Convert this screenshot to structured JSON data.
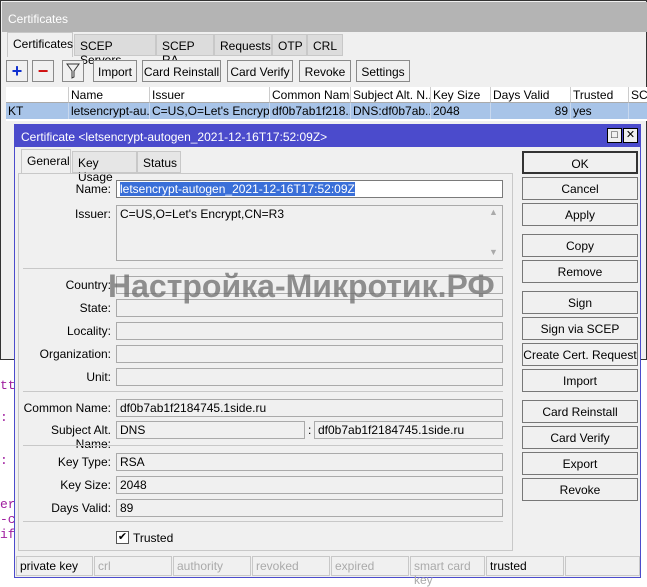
{
  "outer": {
    "title": "Certificates",
    "tabs": [
      "Certificates",
      "SCEP Servers",
      "SCEP RA",
      "Requests",
      "OTP",
      "CRL"
    ],
    "toolbar": {
      "add": "+",
      "remove": "−",
      "import": "Import",
      "card_reinstall": "Card Reinstall",
      "card_verify": "Card Verify",
      "revoke": "Revoke",
      "settings": "Settings"
    },
    "columns": [
      "",
      "Name",
      "Issuer",
      "Common Name",
      "Subject Alt. N...",
      "Key Size",
      "Days Valid",
      "Trusted",
      "SC"
    ],
    "row": [
      "KT",
      "letsencrypt-au...",
      "C=US,O=Let's Encrypt...",
      "df0b7ab1f218...",
      "DNS:df0b7ab...",
      "2048",
      "89",
      "yes",
      ""
    ]
  },
  "dialog": {
    "title": "Certificate <letsencrypt-autogen_2021-12-16T17:52:09Z>",
    "tabs": [
      "General",
      "Key Usage",
      "Status"
    ],
    "fields": {
      "name_label": "Name:",
      "name": "letsencrypt-autogen_2021-12-16T17:52:09Z",
      "issuer_label": "Issuer:",
      "issuer": "C=US,O=Let's Encrypt,CN=R3",
      "country_label": "Country:",
      "state_label": "State:",
      "locality_label": "Locality:",
      "organization_label": "Organization:",
      "unit_label": "Unit:",
      "common_name_label": "Common Name:",
      "common_name": "df0b7ab1f2184745.1side.ru",
      "san_label": "Subject Alt. Name:",
      "san_type": "DNS",
      "san_sep": ":",
      "san_value": "df0b7ab1f2184745.1side.ru",
      "key_type_label": "Key Type:",
      "key_type": "RSA",
      "key_size_label": "Key Size:",
      "key_size": "2048",
      "days_valid_label": "Days Valid:",
      "days_valid": "89",
      "trusted_label": "Trusted"
    },
    "trusted_checked": true,
    "buttons": [
      "OK",
      "Cancel",
      "Apply",
      "Copy",
      "Remove",
      "Sign",
      "Sign via SCEP",
      "Create Cert. Request",
      "Import",
      "Card Reinstall",
      "Card Verify",
      "Export",
      "Revoke"
    ],
    "status": [
      "private key",
      "crl",
      "authority",
      "revoked",
      "expired",
      "smart card key",
      "trusted",
      ""
    ],
    "status_active": [
      true,
      false,
      false,
      false,
      false,
      false,
      true,
      false
    ]
  },
  "watermark": "Настройка-Микротик.РФ",
  "background_code": [
    "tt",
    ":",
    ":",
    "er",
    "-c",
    "if"
  ],
  "colors": {
    "title_bar": "#4b4bcc",
    "selection": "#a8c4e8",
    "add": "#1030d0",
    "remove": "#d01010"
  }
}
